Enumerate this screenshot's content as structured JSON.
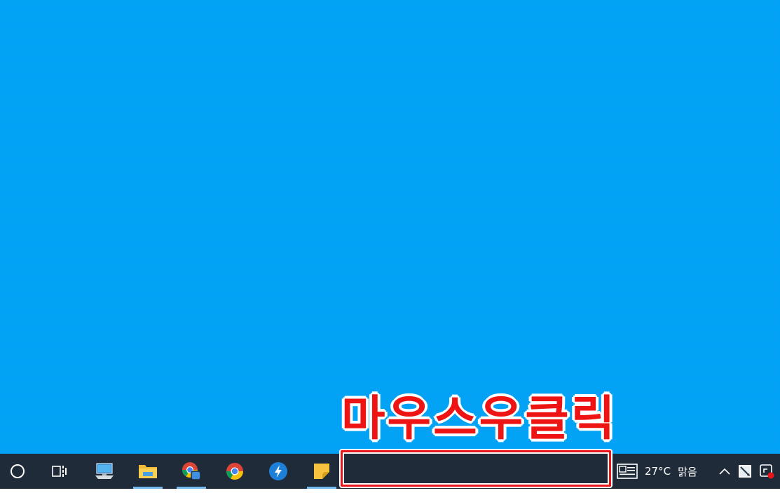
{
  "annotation": {
    "text": "마우스우클릭"
  },
  "taskbar": {
    "icons": {
      "cortana": "cortana-circle-icon",
      "task_view": "task-view-icon",
      "this_pc": "computer-icon",
      "file_explorer": "folder-icon",
      "chrome_profile": "chrome-profile-icon",
      "chrome": "chrome-icon",
      "messenger": "lightning-icon",
      "sticky_notes": "sticky-note-icon"
    },
    "weather": {
      "temp": "27°C",
      "condition": "맑음"
    },
    "tray_icons": [
      "chevron-up-icon",
      "pen-icon",
      "app-notification-icon"
    ]
  },
  "colors": {
    "desktop": "#00a3f5",
    "taskbar": "#1f2b38",
    "annotation": "#ef1414",
    "active_indicator": "#76b9ed"
  }
}
